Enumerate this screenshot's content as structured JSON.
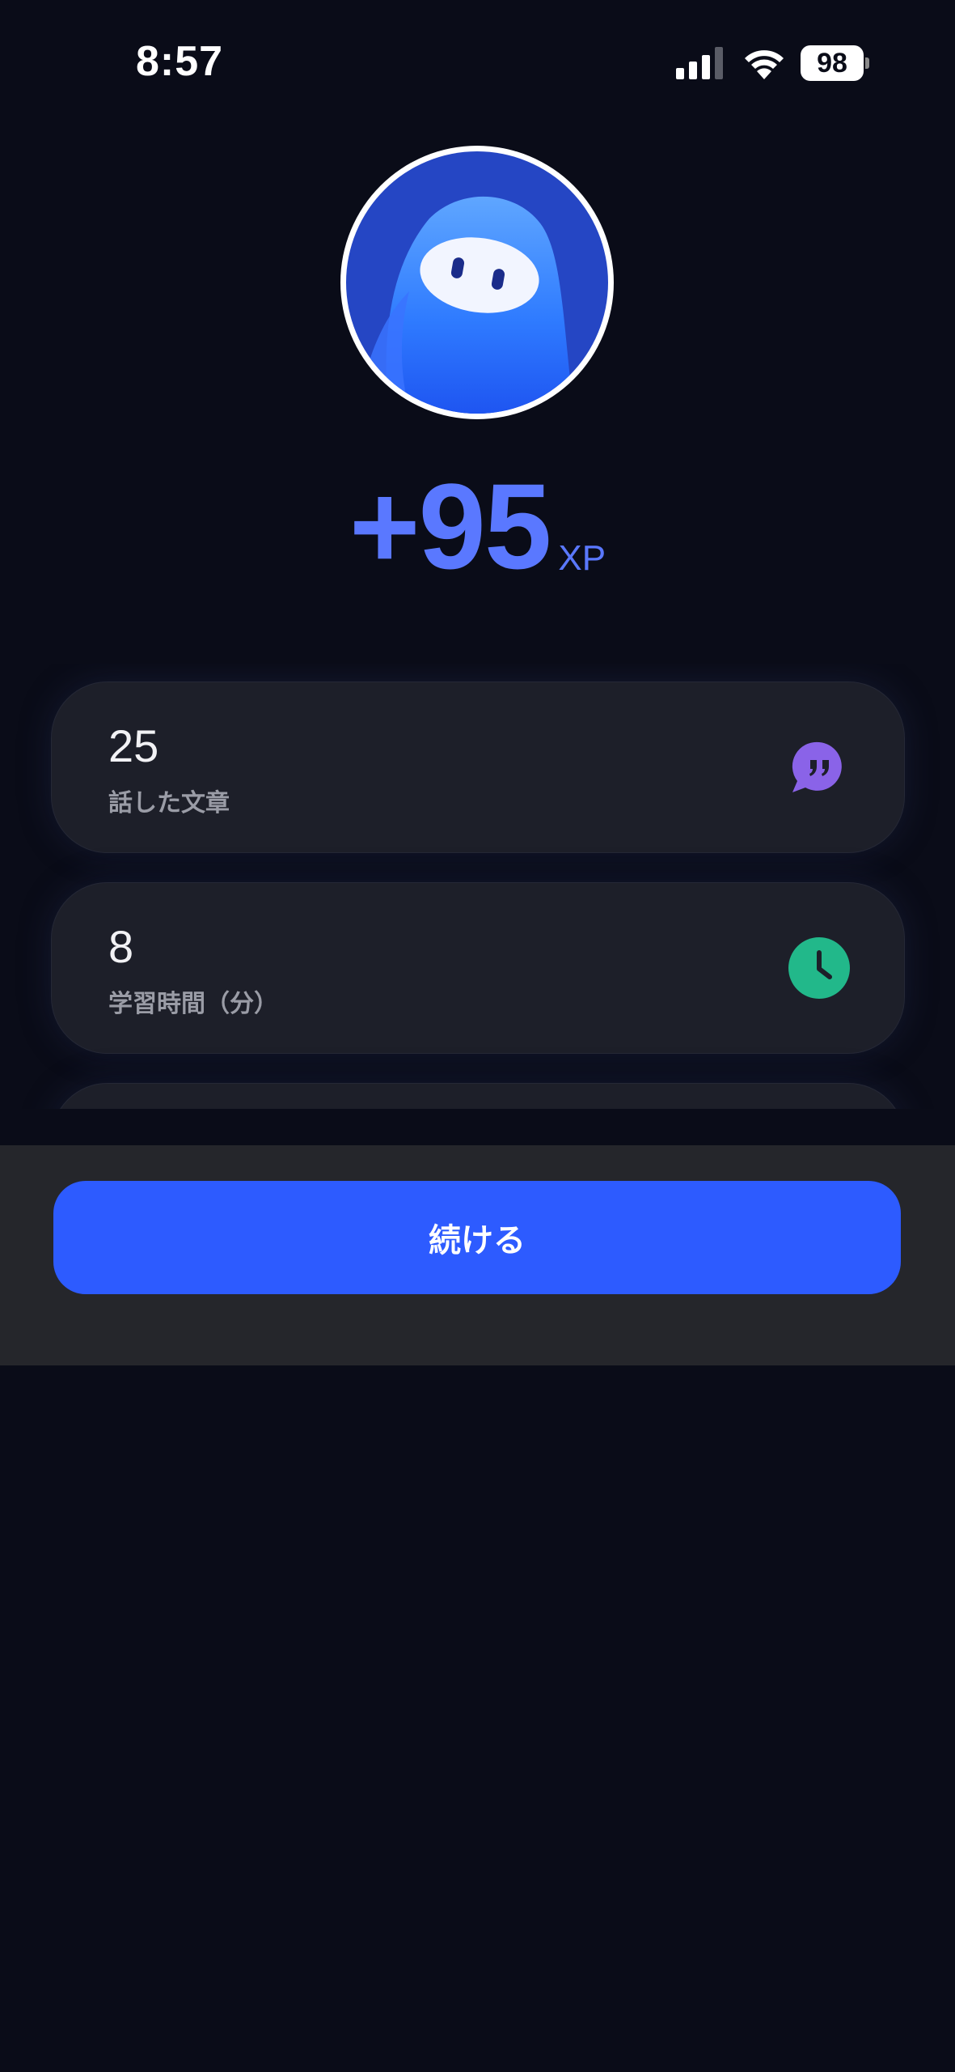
{
  "status_bar": {
    "time": "8:57",
    "battery": "98",
    "signal_icon": "cellular-signal-icon",
    "wifi_icon": "wifi-icon"
  },
  "avatar": {
    "icon": "ghost-mascot-avatar"
  },
  "xp": {
    "value": "+95",
    "unit": "XP",
    "color": "#5a78ff"
  },
  "stats": [
    {
      "value": "25",
      "label": "話した文章",
      "icon": "quote-bubble-icon",
      "icon_color": "#8a63e8"
    },
    {
      "value": "8",
      "label": "学習時間（分）",
      "icon": "clock-icon",
      "icon_color": "#22b88a"
    }
  ],
  "actions": {
    "continue_label": "続ける",
    "button_color": "#2d5bff"
  }
}
